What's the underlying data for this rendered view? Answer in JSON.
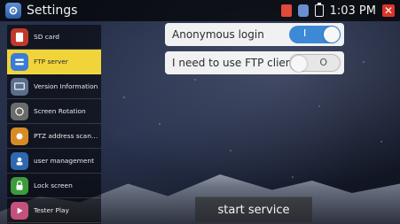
{
  "statusbar": {
    "title": "Settings",
    "time": "1:03 PM",
    "icons": [
      "app-settings-icon",
      "sd-card-status-icon",
      "connection-status-icon",
      "battery-icon",
      "close-icon"
    ]
  },
  "sidebar": {
    "items": [
      {
        "label": "SD card",
        "icon": "sd-card-icon",
        "selected": false,
        "color": "#c0392b"
      },
      {
        "label": "FTP server",
        "icon": "ftp-icon",
        "selected": true,
        "color": "#3a7bd5"
      },
      {
        "label": "Version Information",
        "icon": "monitor-icon",
        "selected": false,
        "color": "#5b6e8c"
      },
      {
        "label": "Screen Rotation",
        "icon": "rotate-icon",
        "selected": false,
        "color": "#6b6b6b"
      },
      {
        "label": "PTZ address scann...",
        "icon": "ptz-icon",
        "selected": false,
        "color": "#d88a26"
      },
      {
        "label": "user management",
        "icon": "user-management-icon",
        "selected": false,
        "color": "#2f68b2"
      },
      {
        "label": "Lock screen",
        "icon": "lock-icon",
        "selected": false,
        "color": "#3c9b3a"
      },
      {
        "label": "Tester Play",
        "icon": "tester-play-icon",
        "selected": false,
        "color": "#c4507c"
      }
    ]
  },
  "settings": {
    "anonymous_login": {
      "label": "Anonymous login",
      "state": "on",
      "mark": "I"
    },
    "ftp_client": {
      "label": "I need to use FTP client",
      "state": "off",
      "mark": "O"
    }
  },
  "actions": {
    "start_label": "start service"
  }
}
